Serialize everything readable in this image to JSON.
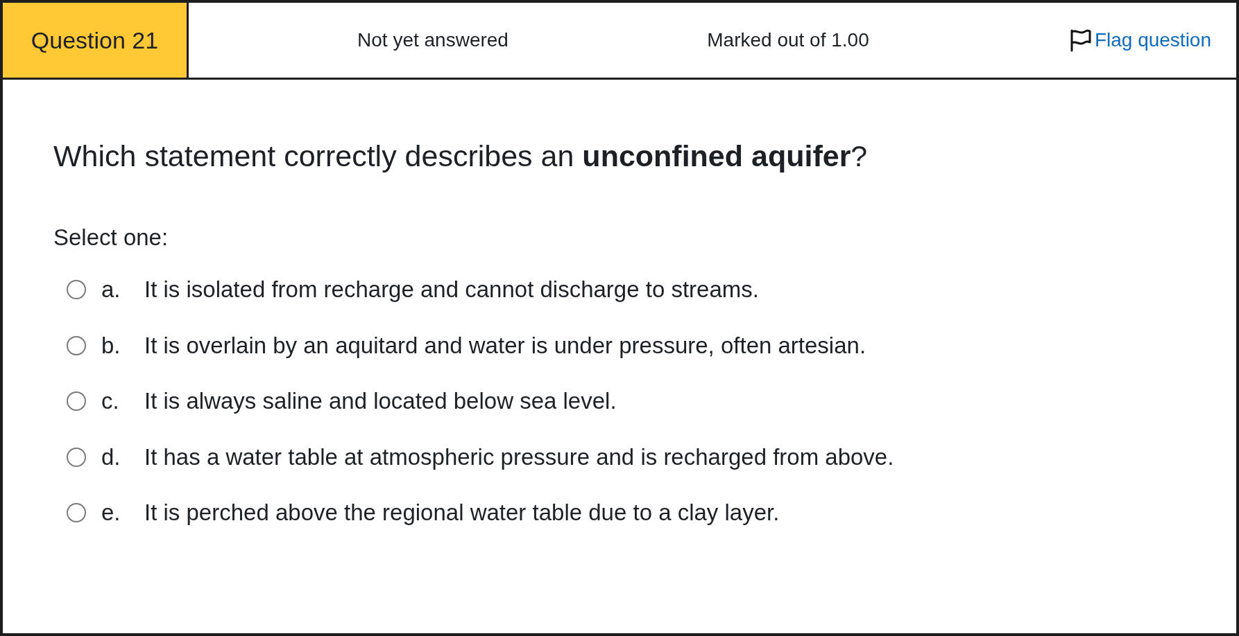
{
  "question_header": {
    "number_label": "Question 21",
    "status": "Not yet answered",
    "marks": "Marked out of 1.00",
    "flag_link": "Flag question"
  },
  "question": {
    "text": "Which statement correctly describes an **unconfined aquifer**?",
    "prompt": "Select one:",
    "options": [
      {
        "letter": "a.",
        "text": "It is isolated from recharge and cannot discharge to streams.",
        "selected": false
      },
      {
        "letter": "b.",
        "text": "It is overlain by an aquitard and water is under pressure, often artesian.",
        "selected": false
      },
      {
        "letter": "c.",
        "text": "It is always saline and located below sea level.",
        "selected": false
      },
      {
        "letter": "d.",
        "text": "It has a water table at atmospheric pressure and is recharged from above.",
        "selected": false
      },
      {
        "letter": "e.",
        "text": "It is perched above the regional water table due to a clay layer.",
        "selected": false
      }
    ]
  }
}
